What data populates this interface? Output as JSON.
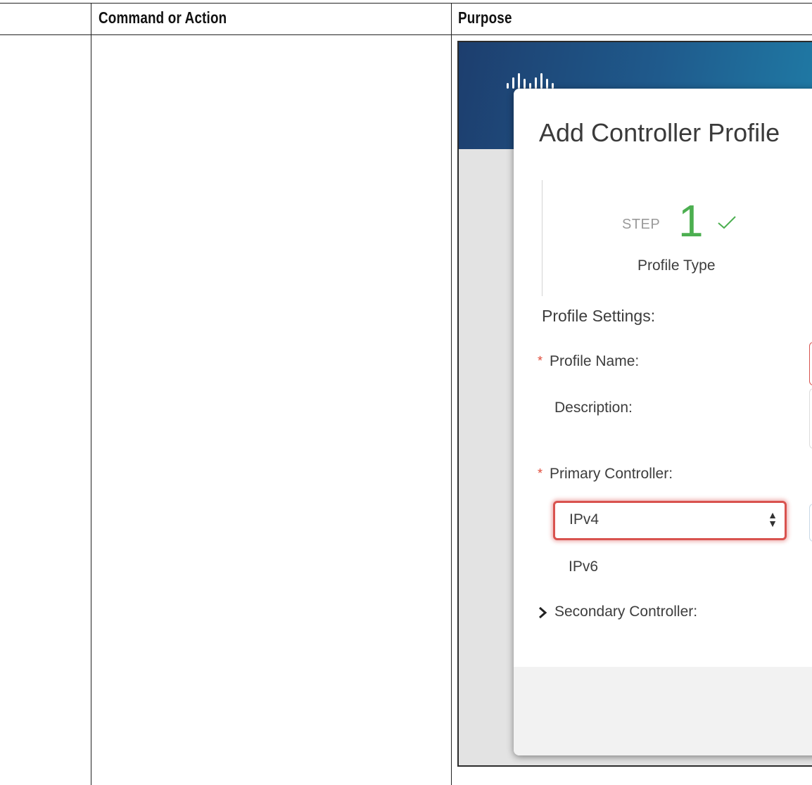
{
  "table": {
    "columns": [
      "",
      "Command or Action",
      "Purpose"
    ]
  },
  "screenshot": {
    "header_color": "#1f5a8c",
    "logo": "cisco-logo-icon",
    "modal": {
      "title": "Add Controller Profile",
      "step": {
        "word": "STEP",
        "number": "1",
        "status_icon": "check-icon",
        "label": "Profile Type"
      },
      "section_title": "Profile Settings:",
      "fields": {
        "profile_name": "Profile Name:",
        "description": "Description:",
        "primary_controller": "Primary Controller:",
        "secondary_controller": "Secondary Controller:"
      },
      "ip_select": {
        "selected": "IPv4",
        "other_option": "IPv6"
      },
      "required_color": "#e04b3a",
      "highlight_color": "#d9534f",
      "step_color": "#4caf50"
    }
  }
}
